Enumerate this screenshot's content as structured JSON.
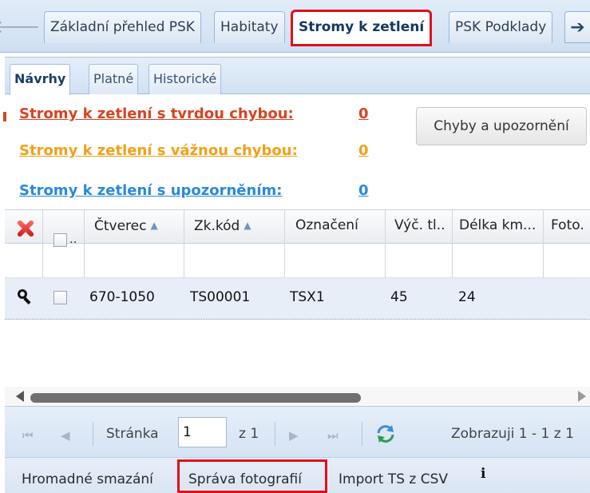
{
  "tabs": {
    "items": [
      {
        "label": "Základní přehled PSK"
      },
      {
        "label": "Habitaty"
      },
      {
        "label": "Stromy k zetlení"
      },
      {
        "label": "PSK Podklady"
      }
    ],
    "active_index": 2
  },
  "subtabs": {
    "items": [
      {
        "label": "Návrhy"
      },
      {
        "label": "Platné"
      },
      {
        "label": "Historické"
      }
    ],
    "active_index": 0
  },
  "errors": {
    "hard": {
      "label": "Stromy k zetlení s tvrdou chybou:",
      "count": "0"
    },
    "serious": {
      "label": "Stromy k zetlení s vážnou chybou:",
      "count": "0"
    },
    "warning": {
      "label": "Stromy k zetlení s upozorněním:",
      "count": "0"
    },
    "button_label": "Chyby a upozornění"
  },
  "grid": {
    "header_check_suffix": "..",
    "columns": [
      {
        "label": "Čtverec"
      },
      {
        "label": "Zk.kód"
      },
      {
        "label": "Označení"
      },
      {
        "label": "Výč. tl.."
      },
      {
        "label": "Délka km..."
      },
      {
        "label": "Foto."
      }
    ],
    "rows": [
      {
        "ctverec": "670-1050",
        "zk_kod": "TS00001",
        "oznaceni": "TSX1",
        "vyc_tl": "45",
        "delka": "24",
        "foto": ""
      }
    ]
  },
  "pager": {
    "page_label": "Stránka",
    "page_value": "1",
    "of_label": "z 1",
    "display_text": "Zobrazuji 1 - 1 z 1"
  },
  "toolbar": {
    "mass_delete": "Hromadné smazání",
    "photo_manage": "Správa fotografií",
    "import_csv": "Import TS z CSV",
    "info_icon": "i"
  },
  "colors": {
    "hard_error": "#d8431f",
    "serious_error": "#f0a11a",
    "warning": "#2a8ad8",
    "highlight": "#e0101a"
  }
}
